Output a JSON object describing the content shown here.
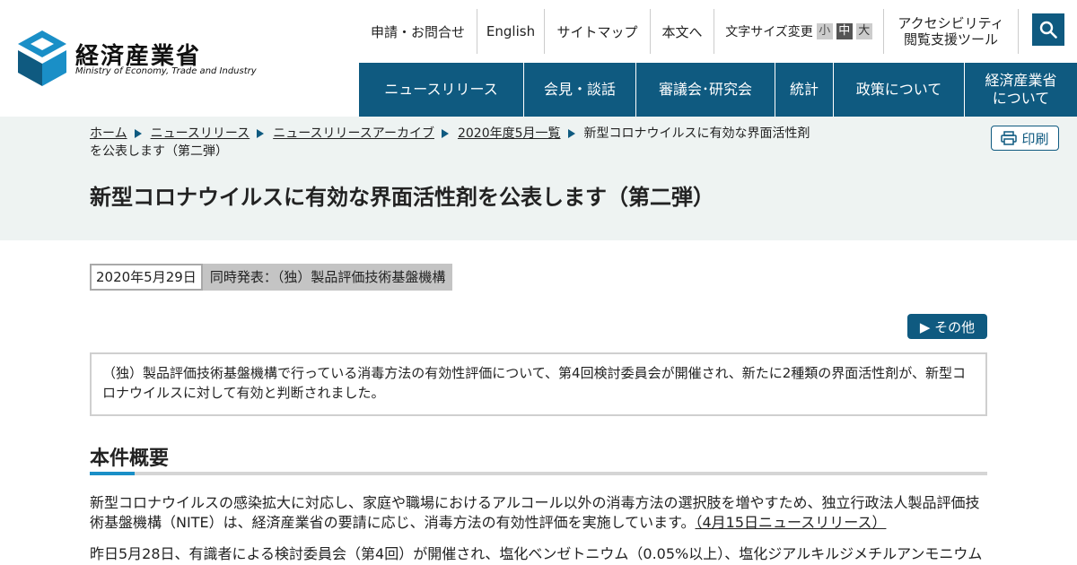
{
  "logo": {
    "name_jp": "経済産業省",
    "name_en": "Ministry of Economy, Trade and Industry"
  },
  "util_nav": {
    "contact": "申請・お問合せ",
    "english": "English",
    "sitemap": "サイトマップ",
    "skip": "本文へ",
    "font_size_label": "文字サイズ変更",
    "font_sizes": [
      "小",
      "中",
      "大"
    ],
    "a11y_line1": "アクセシビリティ",
    "a11y_line2": "閲覧支援ツール"
  },
  "search": {
    "icon": "search-icon"
  },
  "main_nav": [
    {
      "label": "ニュースリリース"
    },
    {
      "label": "会見・談話"
    },
    {
      "label": "審議会･研究会"
    },
    {
      "label": "統計"
    },
    {
      "label": "政策について"
    },
    {
      "label_line1": "経済産業省",
      "label_line2": "について"
    }
  ],
  "breadcrumb": {
    "home": "ホーム",
    "news": "ニュースリリース",
    "archive": "ニュースリリースアーカイブ",
    "month": "2020年度5月一覧",
    "current": "新型コロナウイルスに有効な界面活性剤を公表します（第二弾）"
  },
  "print_label": "印刷",
  "page_title": "新型コロナウイルスに有効な界面活性剤を公表します（第二弾）",
  "meta": {
    "date": "2020年5月29日",
    "joint": "同時発表：（独）製品評価技術基盤機構"
  },
  "other_label": "▶ その他",
  "summary": "（独）製品評価技術基盤機構で行っている消毒方法の有効性評価について、第4回検討委員会が開催され、新たに2種類の界面活性剤が、新型コロナウイルスに対して有効と判断されました。",
  "section": {
    "title": "本件概要",
    "p1_text": "新型コロナウイルスの感染拡大に対応し、家庭や職場におけるアルコール以外の消毒方法の選択肢を増やすため、独立行政法人製品評価技術基盤機構（NITE）は、経済産業省の要請に応じ、消毒方法の有効性評価を実施しています。",
    "p1_link": "（4月15日ニュースリリース）",
    "p2_text": "昨日5月28日、有識者による検討委員会（第4回）が開催され、塩化ベンゼトニウム（0.05%以上）、塩化ジアルキルジメチルアンモニウム"
  },
  "colors": {
    "brand": "#0f5a80",
    "band": "#eef3f2",
    "accent": "#1a8fc7"
  }
}
